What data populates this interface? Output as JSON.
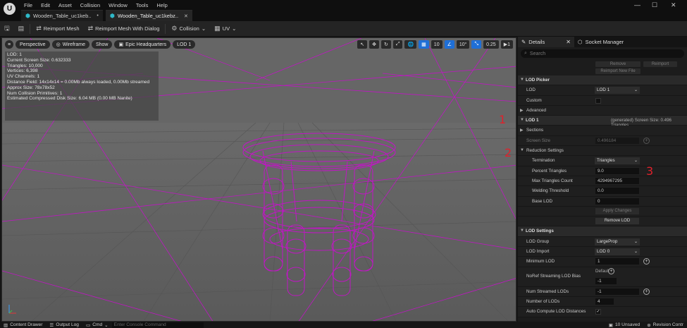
{
  "colors": {
    "accent": "#1f6fd6",
    "wire": "#c016c4",
    "annotation": "#e0212b",
    "tab_icon": "#2fb9c9"
  },
  "menu": [
    "File",
    "Edit",
    "Asset",
    "Collision",
    "Window",
    "Tools",
    "Help"
  ],
  "tabs": [
    {
      "label": "Wooden_Table_uc1keb..",
      "suffix": "•",
      "icon": "mesh-icon"
    },
    {
      "label": "Wooden_Table_uc1kebz..",
      "suffix": "✕",
      "icon": "mesh-icon"
    }
  ],
  "toolbar": {
    "reimport": "Reimport Mesh",
    "reimport_dialog": "Reimport Mesh With Dialog",
    "collision": "Collision",
    "uv": "UV"
  },
  "viewport": {
    "perspective": "Perspective",
    "wireframe": "Wireframe",
    "show": "Show",
    "epic": "Epic Headquarters",
    "lod": "LOD 1",
    "grid_snap": "10",
    "rot_snap": "10°",
    "scale_snap": "0.25",
    "camera_speed": "1"
  },
  "stats": [
    "LOD:  1",
    "Current Screen Size:  0.632333",
    "Triangles:  10,000",
    "Vertices:  6,398",
    "UV Channels:  1",
    "Distance Field:  14x14x14 = 0.00Mb always loaded, 0.00Mb streamed",
    "Approx Size: 78x78x52",
    "Num Collision Primitives:  1",
    "Estimated Compressed Disk Size: 6.04 MB (0.00 MB Nanite)"
  ],
  "annotations": [
    "1",
    "2",
    "3"
  ],
  "details": {
    "tab": "Details",
    "tab2": "Socket Manager",
    "search_placeholder": "Search",
    "remove": "Remove",
    "reimport": "Reimport",
    "reimport_new": "Reimport New File",
    "lod_picker": "LOD Picker",
    "lod_label": "LOD",
    "lod_value": "LOD 1",
    "custom": "Custom",
    "advanced": "Advanced",
    "lod1": "LOD 1",
    "lod1_info": "(generated)  Screen Size: 0.496  Triangles",
    "sections": "Sections",
    "screen_size": "Screen Size",
    "screen_size_value": "0.496184",
    "reduction": "Reduction Settings",
    "termination": "Termination",
    "termination_value": "Triangles",
    "percent_triangles": "Percent Triangles",
    "percent_value": "9.0",
    "max_triangles": "Max Triangles Count",
    "max_value": "4294967295",
    "welding": "Welding Threshold",
    "welding_value": "0.0",
    "base_lod": "Base LOD",
    "base_lod_value": "0",
    "apply": "Apply Changes",
    "remove_lod": "Remove LOD",
    "lod_settings": "LOD Settings",
    "lod_group": "LOD Group",
    "lod_group_value": "LargeProp",
    "lod_import": "LOD Import",
    "lod_import_value": "LOD 0",
    "min_lod": "Minimum LOD",
    "min_lod_value": "1",
    "noref": "NoRef Streaming LOD Bias",
    "noref_default": "Default",
    "noref_value": "-1",
    "num_streamed": "Num Streamed LODs",
    "num_streamed_value": "-1",
    "num_lods": "Number of LODs",
    "num_lods_value": "4",
    "auto_compute": "Auto Compute LOD Distances"
  },
  "statusbar": {
    "content_drawer": "Content Drawer",
    "output_log": "Output Log",
    "cmd": "Cmd",
    "console_placeholder": "Enter Console Command",
    "unsaved": "10 Unsaved",
    "revision": "Revision Contr"
  }
}
